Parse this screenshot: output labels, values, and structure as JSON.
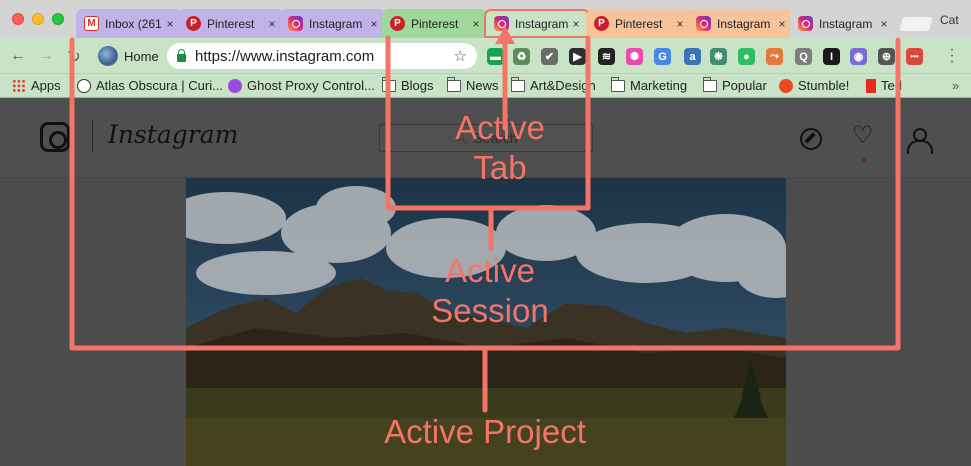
{
  "window": {
    "profile_name": "Cat"
  },
  "tabs": [
    {
      "title": "Inbox (261",
      "icon": "gmail-icon",
      "color": "#c0b3e8",
      "favicon_text": "M"
    },
    {
      "title": "Pinterest",
      "icon": "pinterest-icon",
      "color": "#c0b3e8",
      "favicon_text": "P"
    },
    {
      "title": "Instagram",
      "icon": "instagram-icon",
      "color": "#c0b3e8",
      "favicon_text": ""
    },
    {
      "title": "Pinterest",
      "icon": "pinterest-icon",
      "color": "#9fd89a",
      "favicon_text": "P"
    },
    {
      "title": "Instagram",
      "icon": "instagram-icon",
      "color": "#c9e3c7",
      "favicon_text": "",
      "active": true
    },
    {
      "title": "Pinterest",
      "icon": "pinterest-icon",
      "color": "#f6c39b",
      "favicon_text": "P"
    },
    {
      "title": "Instagram",
      "icon": "instagram-icon",
      "color": "#f6c39b",
      "favicon_text": ""
    },
    {
      "title": "Instagram",
      "icon": "instagram-icon",
      "color": "#d4d4d4",
      "favicon_text": ""
    }
  ],
  "toolbar": {
    "home_label": "Home",
    "url": "https://www.instagram.com"
  },
  "extensions": [
    {
      "name": "grammarly-icon",
      "color": "#15a450",
      "glyph": "▬"
    },
    {
      "name": "recycle-icon",
      "color": "#5a8d5a",
      "glyph": "♻"
    },
    {
      "name": "check-icon",
      "color": "#6b6b6b",
      "glyph": "✔"
    },
    {
      "name": "play-icon",
      "color": "#2e2e2e",
      "glyph": "▶"
    },
    {
      "name": "layers-icon",
      "color": "#222222",
      "glyph": "≋"
    },
    {
      "name": "color-wheel-icon",
      "color": "#e84bb0",
      "glyph": "✺"
    },
    {
      "name": "translate-icon",
      "color": "#4a86e8",
      "glyph": "G"
    },
    {
      "name": "account-icon",
      "color": "#3b73b9",
      "glyph": "a"
    },
    {
      "name": "openai-icon",
      "color": "#3f8f6e",
      "glyph": "❋"
    },
    {
      "name": "evernote-icon",
      "color": "#2dbe60",
      "glyph": "●"
    },
    {
      "name": "arrows-icon",
      "color": "#e6783b",
      "glyph": "⤳"
    },
    {
      "name": "q-icon",
      "color": "#7c7c7c",
      "glyph": "Q"
    },
    {
      "name": "instapaper-icon",
      "color": "#1a1a1a",
      "glyph": "I"
    },
    {
      "name": "target-icon",
      "color": "#7b6bd1",
      "glyph": "◉"
    },
    {
      "name": "globe-icon",
      "color": "#555555",
      "glyph": "⊕"
    },
    {
      "name": "more-ext-icon",
      "color": "#d9473d",
      "glyph": "•••"
    }
  ],
  "bookmarks": [
    {
      "label": "Apps",
      "icon": "apps-grid-icon"
    },
    {
      "label": "Atlas Obscura | Curi...",
      "icon": "atlas-obscura-icon"
    },
    {
      "label": "Ghost Proxy Control...",
      "icon": "ghost-proxy-icon"
    },
    {
      "label": "Blogs",
      "icon": "folder-icon"
    },
    {
      "label": "News",
      "icon": "folder-icon"
    },
    {
      "label": "Art&Design",
      "icon": "folder-icon"
    },
    {
      "label": "Marketing",
      "icon": "folder-icon"
    },
    {
      "label": "Popular",
      "icon": "folder-icon"
    },
    {
      "label": "Stumble!",
      "icon": "stumbleupon-icon"
    },
    {
      "label": "Ted",
      "icon": "ted-icon"
    }
  ],
  "bookmarks_overflow": "»",
  "instagram": {
    "wordmark": "Instagram",
    "search_placeholder": "Search"
  },
  "annotations": {
    "active_tab": "Active\nTab",
    "active_session": "Active\nSession",
    "active_project": "Active Project",
    "color": "#f47467"
  }
}
